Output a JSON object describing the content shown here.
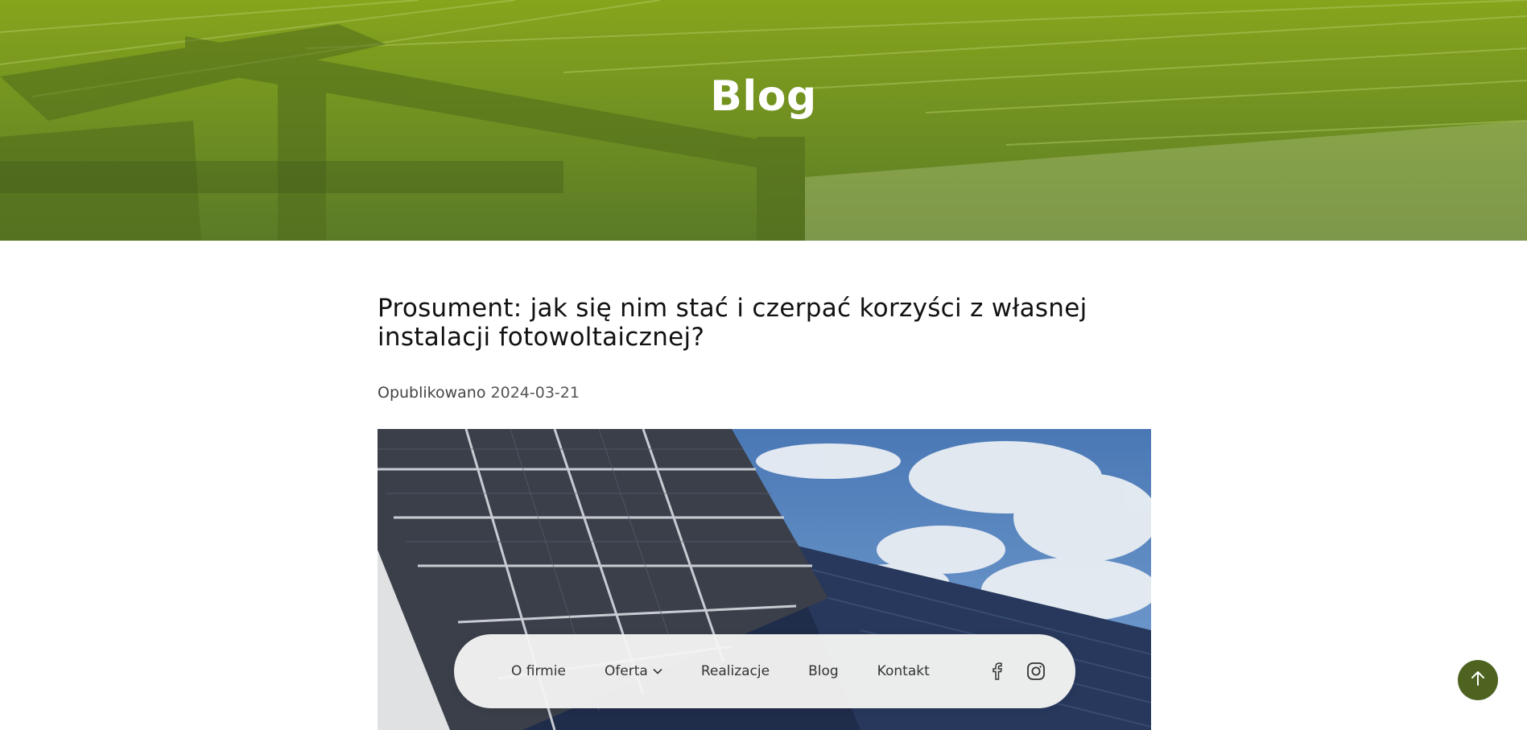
{
  "hero": {
    "title": "Blog"
  },
  "article": {
    "title": "Prosument: jak się nim stać i czerpać korzyści z własnej instalacji fotowoltaicznej?",
    "published_label": "Opublikowano",
    "published_date": "2024-03-21"
  },
  "nav": {
    "items": [
      {
        "label": "O firmie"
      },
      {
        "label": "Oferta",
        "has_dropdown": true
      },
      {
        "label": "Realizacje"
      },
      {
        "label": "Blog"
      },
      {
        "label": "Kontakt"
      }
    ],
    "social": [
      "facebook-icon",
      "instagram-icon"
    ]
  },
  "colors": {
    "hero_overlay": "#6f8f23",
    "scroll_top_bg": "#4e6320",
    "nav_bg": "#f4f4f2"
  }
}
